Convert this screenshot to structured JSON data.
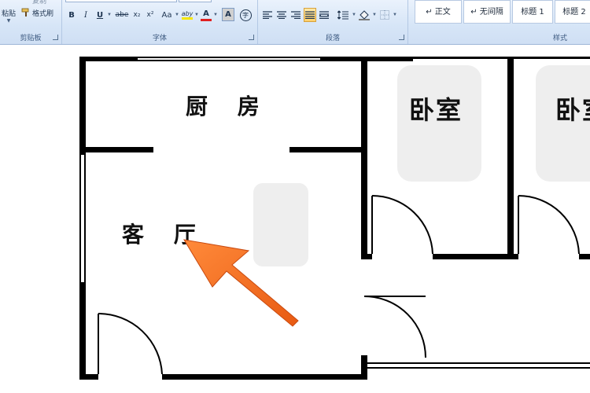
{
  "ribbon": {
    "clipboard": {
      "paste_label": "粘贴",
      "copy_label": "复制",
      "format_painter_label": "格式刷",
      "group_label": "剪贴板"
    },
    "font": {
      "bold": "B",
      "italic": "I",
      "underline": "U",
      "strikethrough": "abe",
      "subscript": "x₂",
      "superscript": "x²",
      "change_case": "Aa",
      "highlight": "aby",
      "font_color": "A",
      "char_shading": "A",
      "enclose": "字",
      "group_label": "字体"
    },
    "paragraph": {
      "group_label": "段落"
    },
    "styles": {
      "items": [
        "↵ 正文",
        "↵ 无间隔",
        "标题 1",
        "标题 2"
      ],
      "group_label": "样式"
    }
  },
  "floorplan": {
    "kitchen": "厨 房",
    "living_room": "客 厅",
    "bedroom_1": "卧室",
    "bedroom_2": "卧室"
  },
  "colors": {
    "arrow": "#f26b21",
    "wall": "#000000",
    "highlight_bar": "#f5e600",
    "font_color_bar": "#e02020"
  }
}
